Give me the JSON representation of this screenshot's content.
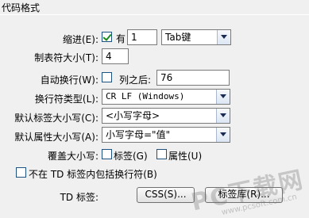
{
  "section": {
    "title": "代码格式"
  },
  "indent": {
    "label": "缩进(E):",
    "checkbox_label": "有",
    "checked": true,
    "value": "1",
    "unit_select": "Tab键"
  },
  "tab_size": {
    "label": "制表符大小(T):",
    "value": "4"
  },
  "auto_wrap": {
    "label": "自动换行(W):",
    "checked": false,
    "after_label": "列之后:",
    "value": "76"
  },
  "line_break": {
    "label": "换行符类型(L):",
    "value": "CR LF (Windows)"
  },
  "tag_case": {
    "label": "默认标签大小写(C):",
    "value": "<小写字母>"
  },
  "attr_case": {
    "label": "默认属性大小写(A):",
    "value": "小写字母=\"值\""
  },
  "override_case": {
    "label": "覆盖大小写:",
    "tag_label": "标签(G)",
    "tag_checked": false,
    "attr_label": "属性(U)",
    "attr_checked": false
  },
  "no_wrap_td": {
    "label": "不在 TD 标签内包括换行符(B)",
    "checked": false
  },
  "td_tags": {
    "label": "TD 标签:",
    "css_button": "CSS(S)...",
    "library_button": "标签库(R)..."
  },
  "watermark": {
    "text": "PC下载网",
    "url": "www.pcsoft.com.cn"
  }
}
